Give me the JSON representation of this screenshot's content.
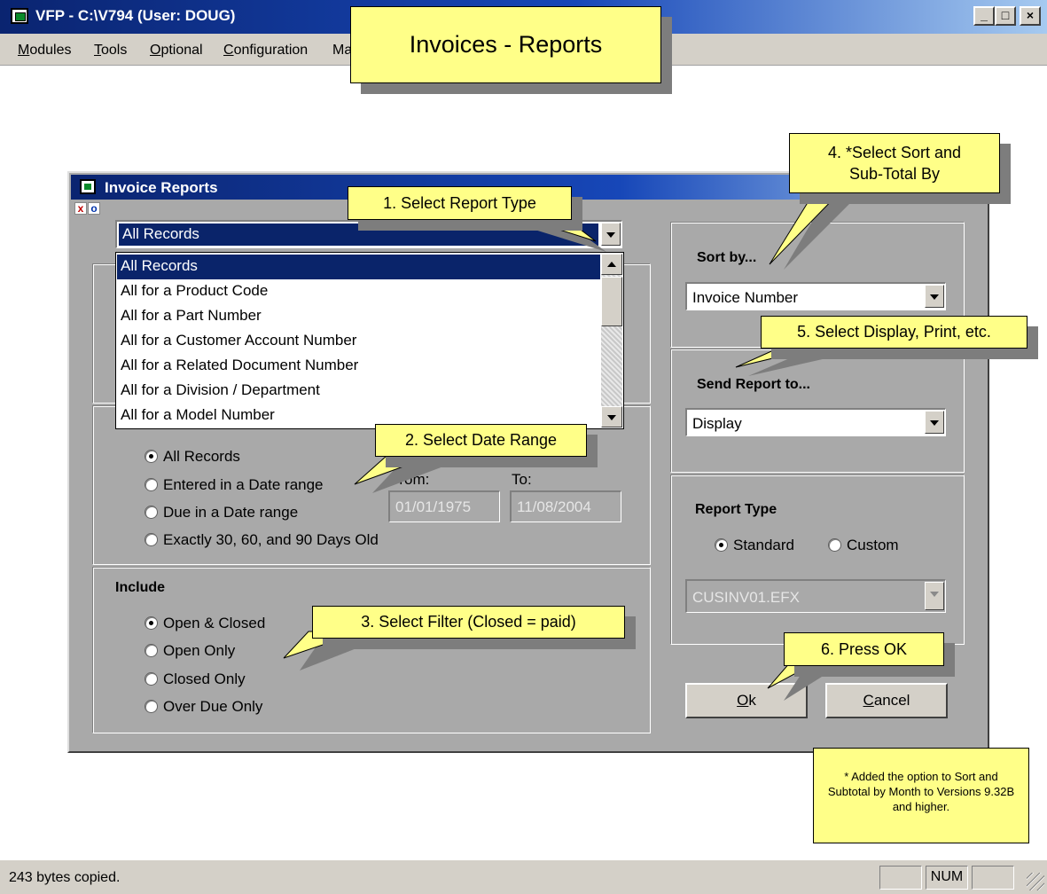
{
  "app": {
    "title": "VFP - C:\\V794  (User: DOUG)",
    "menu": [
      {
        "accel": "M",
        "rest": "odules"
      },
      {
        "accel": "T",
        "rest": "ools"
      },
      {
        "accel": "O",
        "rest": "ptional"
      },
      {
        "accel": "C",
        "rest": "onfiguration"
      },
      {
        "accel": "",
        "rest": "Ma"
      }
    ],
    "window_buttons": [
      "_",
      "□",
      "×"
    ]
  },
  "header_callout": "Invoices - Reports",
  "dialog": {
    "title": "Invoice Reports",
    "mini_x": "x",
    "mini_o": "o",
    "report_type": {
      "selected": "All Records",
      "options": [
        "All Records",
        "All for a Product Code",
        "All for a Part Number",
        "All for a Customer Account Number",
        "All for a Related Document Number",
        "All for a Division / Department",
        "All for a Model Number"
      ]
    },
    "date_range": {
      "options": [
        "All Records",
        "Entered in a Date range",
        "Due in a Date range",
        "Exactly 30, 60, and 90 Days Old"
      ],
      "selected_index": 0,
      "from_label": "From:",
      "to_label": "To:",
      "from_value": "01/01/1975",
      "to_value": "11/08/2004"
    },
    "include": {
      "label": "Include",
      "options": [
        "Open & Closed",
        "Open Only",
        "Closed Only",
        "Over Due Only"
      ],
      "selected_index": 0
    },
    "sort_by": {
      "label": "Sort by...",
      "value": "Invoice Number"
    },
    "send_report": {
      "label": "Send Report to...",
      "value": "Display"
    },
    "report_kind": {
      "label": "Report Type",
      "standard": "Standard",
      "custom": "Custom",
      "selected": "Standard",
      "file": "CUSINV01.EFX"
    },
    "ok_label": {
      "accel": "O",
      "rest": "k"
    },
    "cancel_label": {
      "accel": "C",
      "rest": "ancel"
    }
  },
  "callouts": {
    "c1": "1. Select Report Type",
    "c2": "2. Select Date Range",
    "c3": "3. Select Filter (Closed = paid)",
    "c4_line1": "4. *Select Sort and",
    "c4_line2": "Sub-Total By",
    "c5": "5. Select Display, Print, etc.",
    "c6": "6. Press OK",
    "note": "* Added the option to Sort and Subtotal by Month to Versions 9.32B and higher."
  },
  "status": {
    "message": "243 bytes copied.",
    "num": "NUM"
  },
  "colors": {
    "title_gradient_start": "#0a2470",
    "title_gradient_end": "#a6caf0",
    "dialog_face": "#a9a9a9",
    "selection": "#0a246a",
    "callout_fill": "#ffff88"
  }
}
